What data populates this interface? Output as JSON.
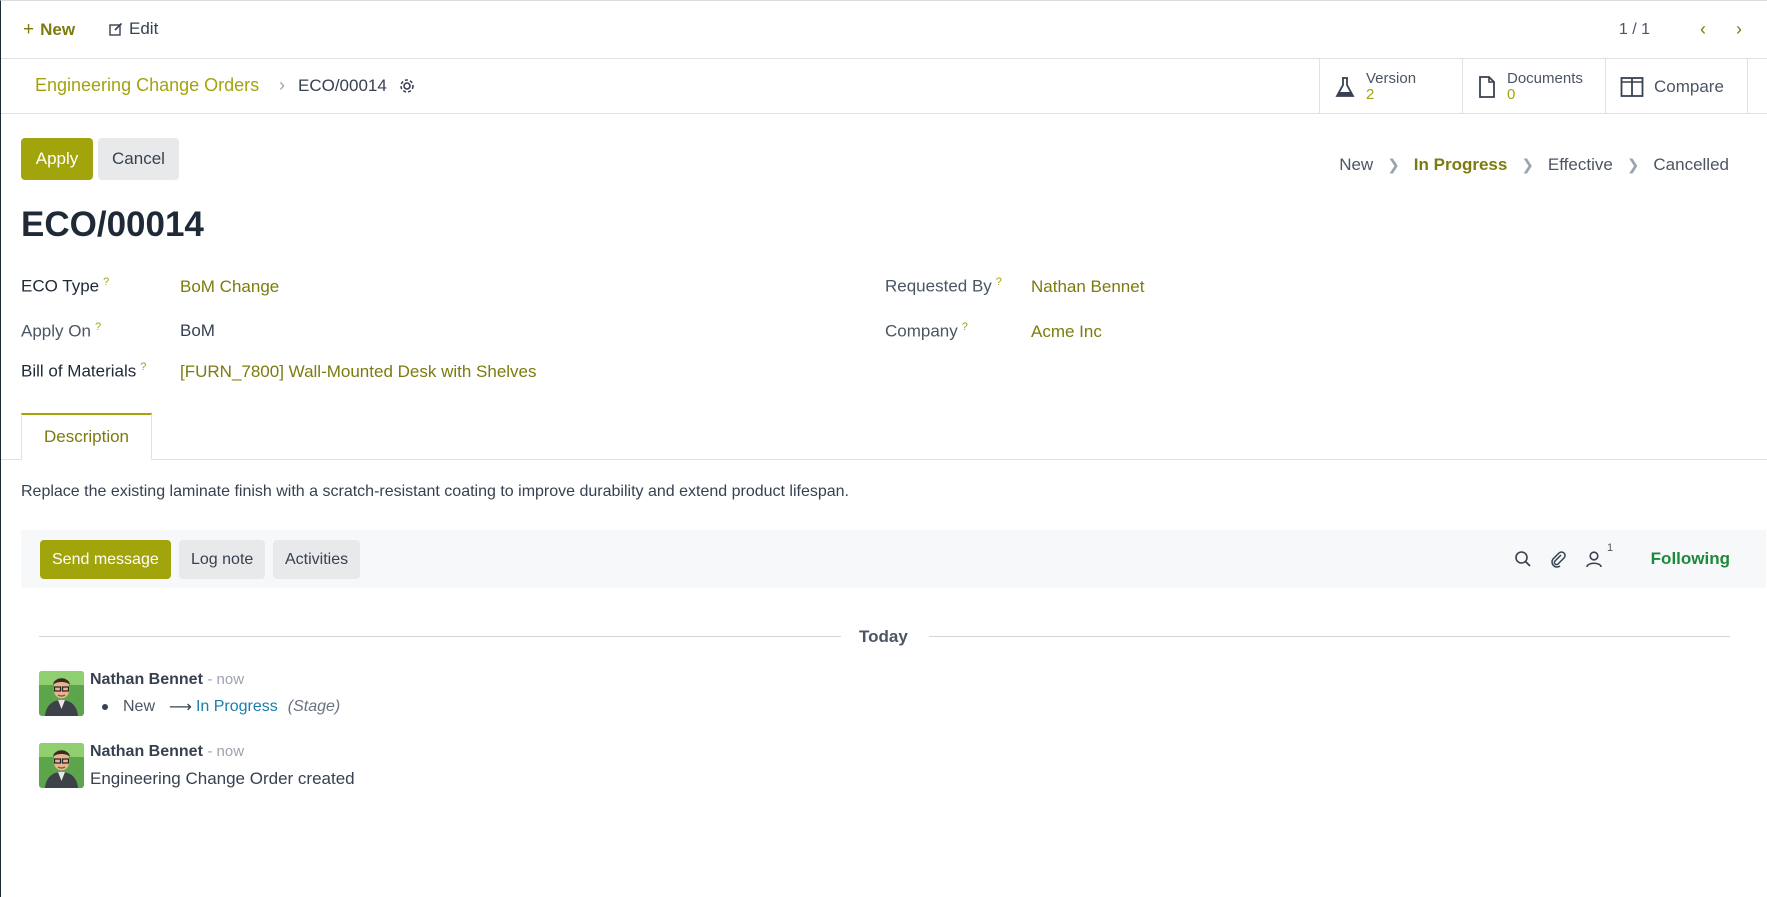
{
  "topbar": {
    "new_label": "New",
    "edit_label": "Edit",
    "pager": "1 / 1"
  },
  "breadcrumb": {
    "parent": "Engineering Change Orders",
    "current": "ECO/00014"
  },
  "stat_buttons": {
    "version_label": "Version",
    "version_value": "2",
    "documents_label": "Documents",
    "documents_value": "0",
    "compare_label": "Compare"
  },
  "actions": {
    "apply_label": "Apply",
    "cancel_label": "Cancel"
  },
  "stages": {
    "items": [
      "New",
      "In Progress",
      "Effective",
      "Cancelled"
    ],
    "active": "In Progress"
  },
  "record": {
    "title": "ECO/00014",
    "eco_type_label": "ECO Type",
    "eco_type_value": "BoM Change",
    "apply_on_label": "Apply On",
    "apply_on_value": "BoM",
    "bom_label": "Bill of Materials",
    "bom_value": "[FURN_7800] Wall-Mounted Desk with Shelves",
    "requested_by_label": "Requested By",
    "requested_by_value": "Nathan Bennet",
    "company_label": "Company",
    "company_value": "Acme Inc",
    "help_mark": "?"
  },
  "tabs": {
    "description_label": "Description"
  },
  "description": "Replace the existing laminate finish with a scratch-resistant coating to improve durability and extend product lifespan.",
  "chatter": {
    "send_message": "Send message",
    "log_note": "Log note",
    "activities": "Activities",
    "follower_count": "1",
    "following": "Following",
    "date_separator": "Today",
    "messages": [
      {
        "author": "Nathan Bennet",
        "time": "- now",
        "from": "New",
        "to": "In Progress",
        "field": "(Stage)"
      },
      {
        "author": "Nathan Bennet",
        "time": "- now",
        "body": "Engineering Change Order created"
      }
    ]
  },
  "colors": {
    "accent": "#a2a40c",
    "accent_text": "#7b7b0e",
    "following": "#1d8a3b",
    "link_blue": "#1a7ea8"
  },
  "icons": [
    "plus-icon",
    "edit-icon",
    "chevron-left-icon",
    "chevron-right-icon",
    "gear-icon",
    "flask-icon",
    "document-icon",
    "compare-icon",
    "search-icon",
    "paperclip-icon",
    "follower-icon",
    "arrow-right-icon"
  ]
}
